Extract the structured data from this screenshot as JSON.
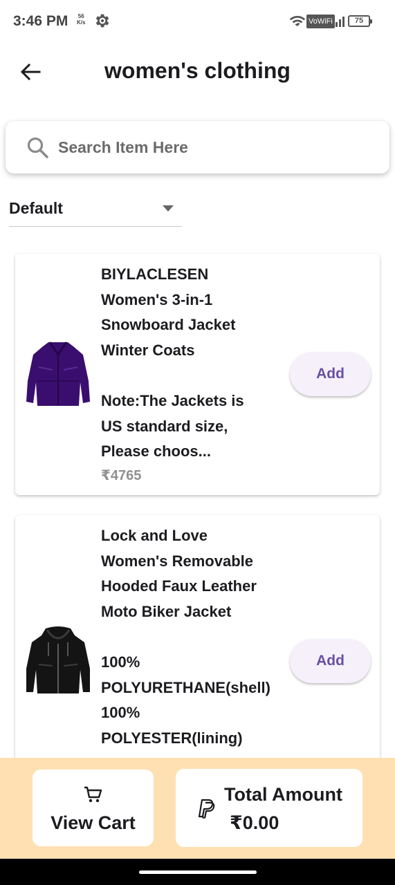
{
  "status_bar": {
    "time": "3:46 PM",
    "speed_value": "56",
    "speed_unit": "K/s",
    "vowifi": "VoWiFi",
    "battery": "75"
  },
  "header": {
    "title": "women's clothing",
    "back_icon": "arrow-left-icon"
  },
  "search": {
    "placeholder": "Search Item Here",
    "value": ""
  },
  "sort": {
    "selected": "Default"
  },
  "products": [
    {
      "title": "BIYLACLESEN\nWomen's 3-in-1\nSnowboard Jacket\nWinter Coats\n\nNote:The Jackets is\nUS standard size,\nPlease choos...",
      "price": "₹4765",
      "add_label": "Add",
      "image": "purple-jacket"
    },
    {
      "title": "Lock and Love\nWomen's Removable\nHooded Faux Leather\nMoto Biker Jacket\n\n100%\nPOLYURETHANE(shell)\n100%\nPOLYESTER(lining)",
      "price": "",
      "add_label": "Add",
      "image": "black-leather-jacket"
    }
  ],
  "bottom_bar": {
    "view_cart_label": "View Cart",
    "total_label": "Total Amount",
    "total_value": "₹0.00"
  },
  "colors": {
    "accent": "#6750a4",
    "button_bg": "#f6f0fa",
    "bottom_bar_bg": "#ffe0b3",
    "price": "#8f8f8f"
  }
}
